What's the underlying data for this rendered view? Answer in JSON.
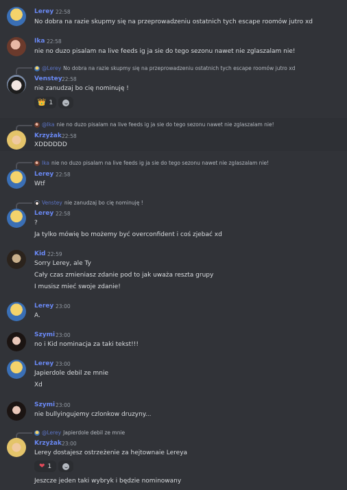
{
  "messages": [
    {
      "author": "Lerey",
      "time": "22:58",
      "lines": [
        "No dobra na razie skupmy się na przeprowadzeniu ostatnich tych escape roomów jutro xd"
      ]
    },
    {
      "author": "Ika",
      "time": "22:58",
      "lines": [
        "nie no duzo pisalam na live feeds ig ja sie do tego sezonu nawet nie zglaszalam nie!"
      ]
    },
    {
      "author": "Venstey",
      "time": "22:58",
      "reply": {
        "mention": "@Lerey",
        "text": "No dobra na razie skupmy się na przeprowadzeniu ostatnich tych escape roomów jutro xd"
      },
      "lines": [
        "nie zanudzaj bo cię nominuję !"
      ],
      "reactions": [
        {
          "emoji": "crown",
          "count": "1"
        }
      ]
    },
    {
      "author": "Krzyżak",
      "time": "22:58",
      "reply": {
        "mention": "@Ika",
        "text": "nie no duzo pisalam na live feeds ig ja sie do tego sezonu nawet nie zglaszalam nie!"
      },
      "lines": [
        "XDDDDDD"
      ]
    },
    {
      "author": "Lerey",
      "time": "22:58",
      "reply": {
        "mention": "Ika",
        "text": "nie no duzo pisalam na live feeds ig ja sie do tego sezonu nawet nie zglaszalam nie!"
      },
      "lines": [
        "Wtf"
      ]
    },
    {
      "author": "Lerey",
      "time": "22:58",
      "reply": {
        "mention": "Venstey",
        "text": "nie zanudzaj bo cię nominuję !"
      },
      "lines": [
        "?",
        "Ja tylko mówię bo możemy być overconfident i coś zjebać xd"
      ]
    },
    {
      "author": "Kid",
      "time": "22:59",
      "lines": [
        "Sorry Lerey, ale Ty",
        "Cały czas zmieniasz zdanie pod to jak uważa reszta grupy",
        "I musisz mieć swoje zdanie!"
      ]
    },
    {
      "author": "Lerey",
      "time": "23:00",
      "lines": [
        "A."
      ]
    },
    {
      "author": "Szymi",
      "time": "23:00",
      "lines": [
        "no i Kid nominacja za taki tekst!!!"
      ]
    },
    {
      "author": "Lerey",
      "time": "23:00",
      "lines": [
        "Japierdole debil ze mnie",
        "Xd"
      ]
    },
    {
      "author": "Szymi",
      "time": "23:00",
      "lines": [
        "nie bullyingujemy czlonkow druzyny..."
      ]
    },
    {
      "author": "Krzyżak",
      "time": "23:00",
      "reply": {
        "mention": "@Lerey",
        "text": "Japierdole debil ze mnie"
      },
      "lines": [
        "Lerey dostajesz ostrzeżenie za hejtownaie Lereya",
        "Jeszcze jeden taki wybryk i będzie nominowany"
      ],
      "reactions": [
        {
          "emoji": "heart",
          "count": "1"
        }
      ]
    }
  ],
  "icons": {
    "add_reaction": "smile-plus-icon",
    "crown": "crown-emoji",
    "heart": "heart-emoji"
  }
}
